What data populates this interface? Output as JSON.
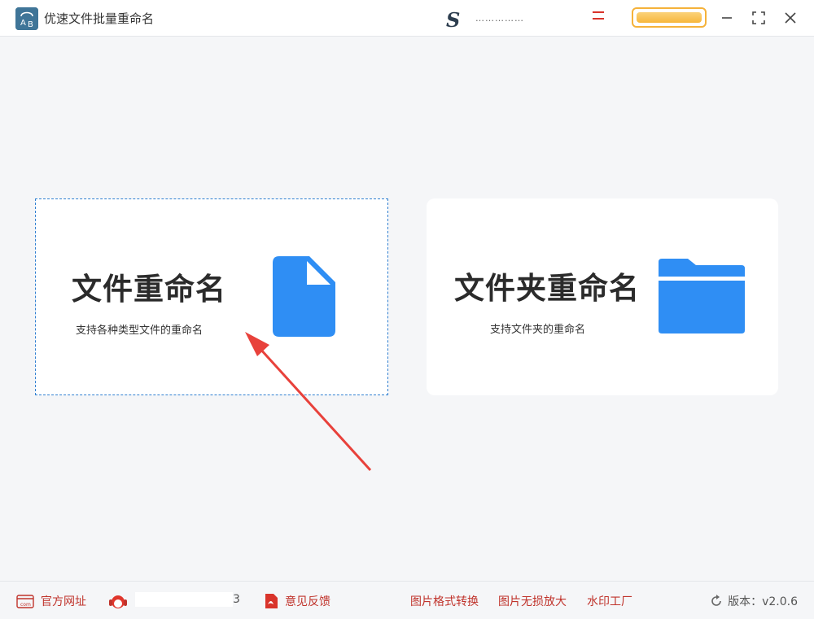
{
  "app": {
    "title": "优速文件批量重命名",
    "logo_text": "AB"
  },
  "header": {
    "brand_letter": "S",
    "brand_text": "……………"
  },
  "cards": [
    {
      "title": "文件重命名",
      "desc": "支持各种类型文件的重命名",
      "icon": "file-icon",
      "selected": true
    },
    {
      "title": "文件夹重命名",
      "desc": "支持文件夹的重命名",
      "icon": "folder-icon",
      "selected": false
    }
  ],
  "footer": {
    "website_label": "官方网址",
    "service_suffix": "3",
    "feedback_label": "意见反馈",
    "links": [
      "图片格式转换",
      "图片无损放大",
      "水印工厂"
    ],
    "version_label": "版本：v2.0.6"
  },
  "colors": {
    "accent": "#2f8ef4",
    "footer_link": "#c0332b",
    "arrow": "#e8413b",
    "upgrade": "#f5b23a"
  }
}
